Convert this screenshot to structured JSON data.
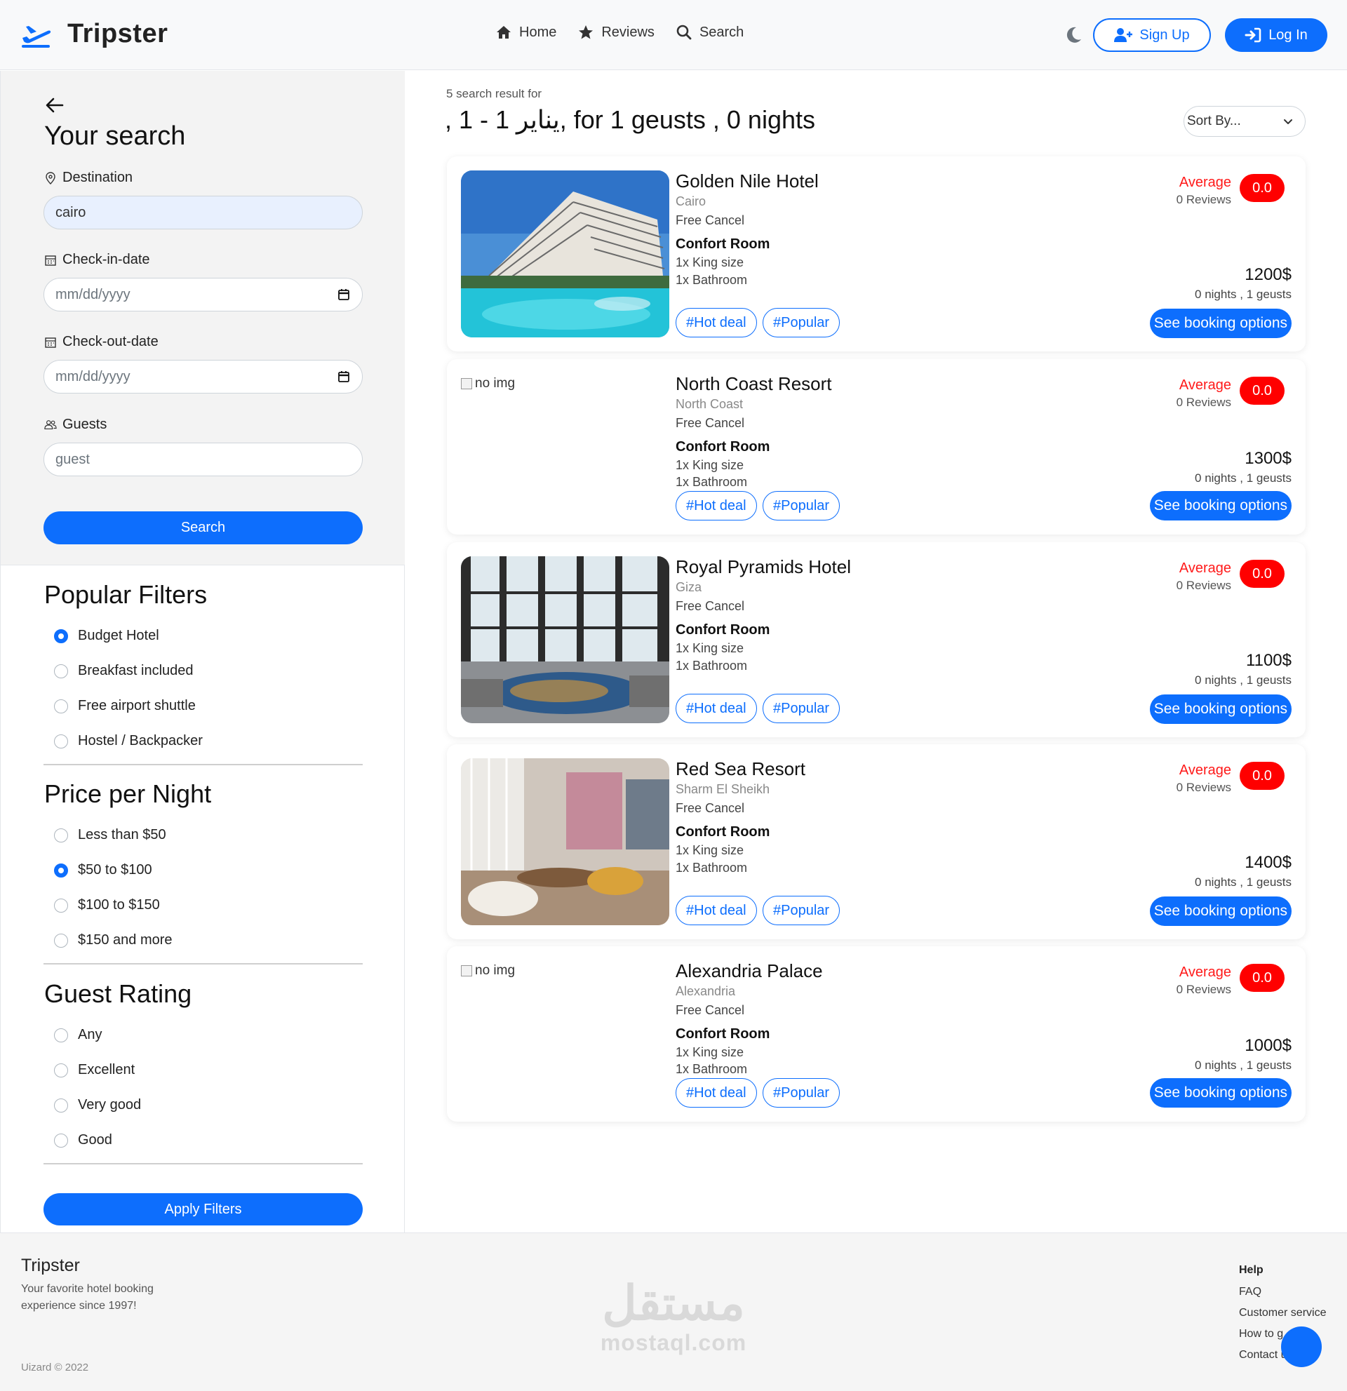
{
  "header": {
    "brand": "Tripster",
    "nav": [
      {
        "label": "Home",
        "icon": "home-icon"
      },
      {
        "label": "Reviews",
        "icon": "star-icon"
      },
      {
        "label": "Search",
        "icon": "search-icon"
      }
    ],
    "signup_label": "Sign Up",
    "login_label": "Log In"
  },
  "search_panel": {
    "title": "Your search",
    "destination_label": "Destination",
    "destination_value": "cairo",
    "checkin_label": "Check-in-date",
    "checkin_placeholder": "mm/dd/yyyy",
    "checkout_label": "Check-out-date",
    "checkout_placeholder": "mm/dd/yyyy",
    "guests_label": "Guests",
    "guests_placeholder": "guest",
    "search_button": "Search"
  },
  "filters": {
    "popular": {
      "title": "Popular Filters",
      "options": [
        "Budget Hotel",
        "Breakfast included",
        "Free airport shuttle",
        "Hostel / Backpacker"
      ],
      "selected": 0
    },
    "price": {
      "title": "Price per Night",
      "options": [
        "Less than $50",
        "$50 to $100",
        "$100 to $150",
        "$150 and more"
      ],
      "selected": 1
    },
    "rating": {
      "title": "Guest Rating",
      "options": [
        "Any",
        "Excellent",
        "Very good",
        "Good"
      ],
      "selected": -1
    },
    "apply_button": "Apply Filters"
  },
  "results": {
    "count_text": "5 search result for",
    "heading": ", 1 - 1 يناير, for 1 geusts , 0 nights",
    "sort_label": "Sort By...",
    "no_img_text": "no img",
    "hotels": [
      {
        "name": "Golden Nile Hotel",
        "city": "Cairo",
        "cancel": "Free Cancel",
        "room": "Confort Room",
        "bed": "1x King size",
        "bath": "1x Bathroom",
        "tags": [
          "#Hot deal",
          "#Popular"
        ],
        "rating_label": "Average",
        "reviews": "0 Reviews",
        "score": "0.0",
        "price": "1200$",
        "meta": "0 nights , 1 geusts",
        "button": "See booking options",
        "image": "pool"
      },
      {
        "name": "North Coast Resort",
        "city": "North Coast",
        "cancel": "Free Cancel",
        "room": "Confort Room",
        "bed": "1x King size",
        "bath": "1x Bathroom",
        "tags": [
          "#Hot deal",
          "#Popular"
        ],
        "rating_label": "Average",
        "reviews": "0 Reviews",
        "score": "0.0",
        "price": "1300$",
        "meta": "0 nights , 1 geusts",
        "button": "See booking options",
        "image": "none"
      },
      {
        "name": "Royal Pyramids Hotel",
        "city": "Giza",
        "cancel": "Free Cancel",
        "room": "Confort Room",
        "bed": "1x King size",
        "bath": "1x Bathroom",
        "tags": [
          "#Hot deal",
          "#Popular"
        ],
        "rating_label": "Average",
        "reviews": "0 Reviews",
        "score": "0.0",
        "price": "1100$",
        "meta": "0 nights , 1 geusts",
        "button": "See booking options",
        "image": "lobby"
      },
      {
        "name": "Red Sea Resort",
        "city": "Sharm El Sheikh",
        "cancel": "Free Cancel",
        "room": "Confort Room",
        "bed": "1x King size",
        "bath": "1x Bathroom",
        "tags": [
          "#Hot deal",
          "#Popular"
        ],
        "rating_label": "Average",
        "reviews": "0 Reviews",
        "score": "0.0",
        "price": "1400$",
        "meta": "0 nights , 1 geusts",
        "button": "See booking options",
        "image": "lounge"
      },
      {
        "name": "Alexandria Palace",
        "city": "Alexandria",
        "cancel": "Free Cancel",
        "room": "Confort Room",
        "bed": "1x King size",
        "bath": "1x Bathroom",
        "tags": [
          "#Hot deal",
          "#Popular"
        ],
        "rating_label": "Average",
        "reviews": "0 Reviews",
        "score": "0.0",
        "price": "1000$",
        "meta": "0 nights , 1 geusts",
        "button": "See booking options",
        "image": "none"
      }
    ]
  },
  "footer": {
    "brand": "Tripster",
    "tagline": "Your favorite hotel booking experience since 1997!",
    "copyright": "Uizard © 2022",
    "watermark_ar": "مستقل",
    "watermark_en": "mostaql.com",
    "help_title": "Help",
    "links": [
      "FAQ",
      "Customer service",
      "How to g",
      "Contact u"
    ]
  },
  "colors": {
    "primary": "#0d6efd",
    "rating_red": "#ff0000",
    "sidebar_bg": "#f3f3f3",
    "header_bg": "#f8f9fa"
  }
}
